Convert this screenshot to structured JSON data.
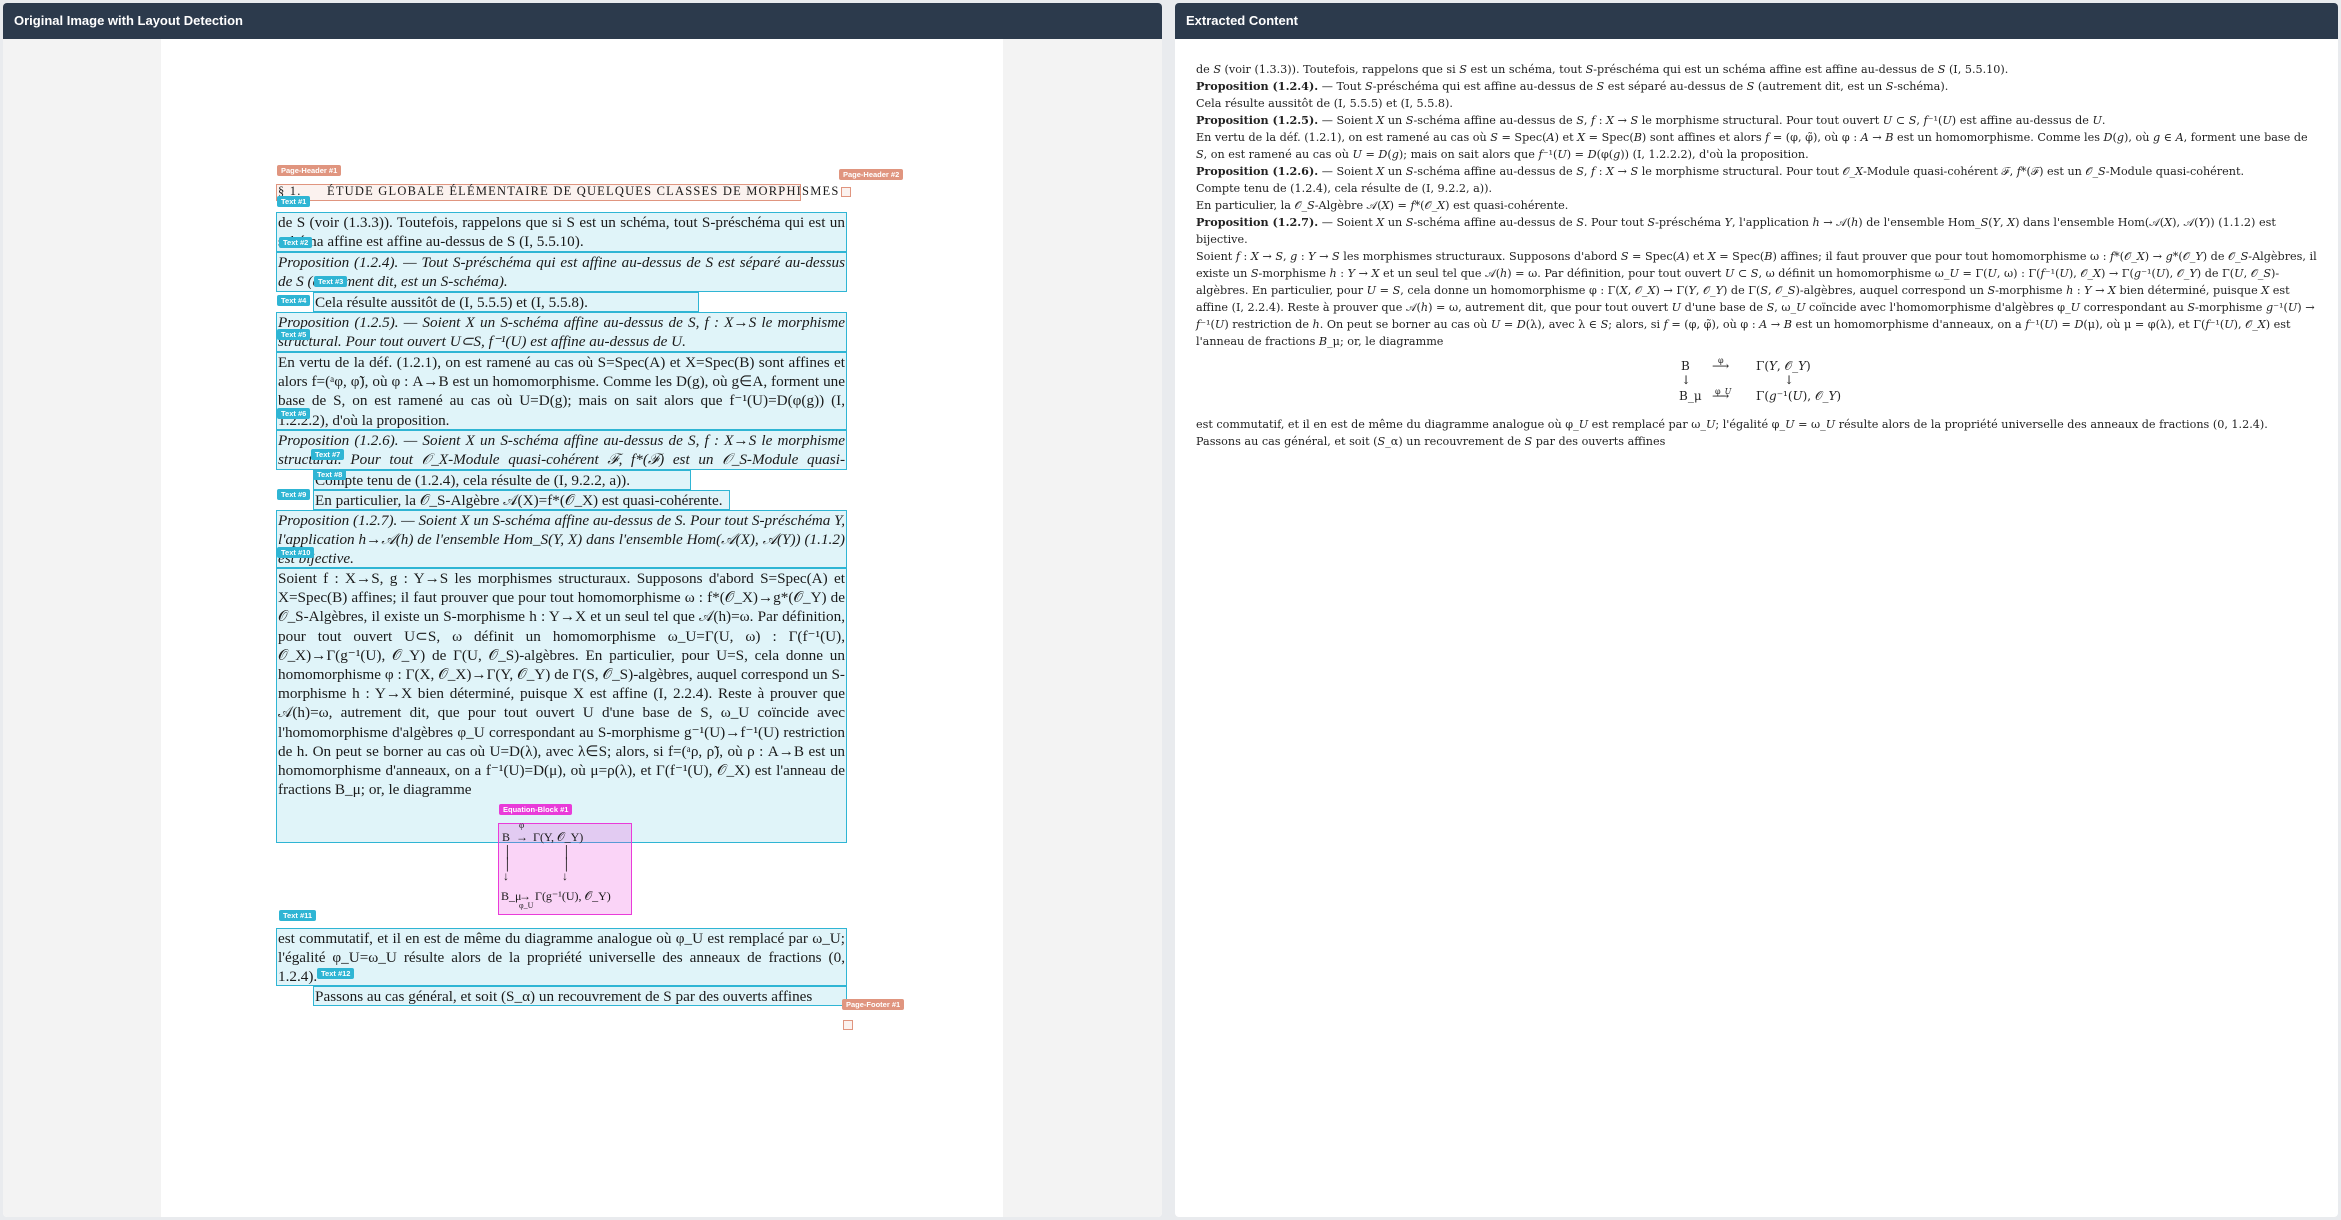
{
  "left_panel": {
    "title": "Original Image with Layout Detection"
  },
  "right_panel": {
    "title": "Extracted Content"
  },
  "page": {
    "header": {
      "section": "§ 1.",
      "title": "ÉTUDE GLOBALE ÉLÉMENTAIRE DE QUELQUES CLASSES DE MORPHISMES"
    },
    "labels": {
      "ph1": "Page-Header #1",
      "ph2": "Page-Header #2",
      "t1": "Text #1",
      "t2": "Text #2",
      "t3": "Text #3",
      "t4": "Text #4",
      "t5": "Text #5",
      "t6": "Text #6",
      "t7": "Text #7",
      "t8": "Text #8",
      "t9": "Text #9",
      "t10": "Text #10",
      "t11": "Text #11",
      "t12": "Text #12",
      "eq1": "Equation-Block #1",
      "pf1": "Page-Footer #1"
    },
    "text1": "de S (voir (1.3.3)). Toutefois, rappelons que si S est un schéma, tout S-préschéma qui est un schéma affine est affine au-dessus de S (I, 5.5.10).",
    "text2": "Proposition (1.2.4). — Tout S-préschéma qui est affine au-dessus de S est séparé au-dessus de S (autrement dit, est un S-schéma).",
    "text3": "Cela résulte aussitôt de (I, 5.5.5) et (I, 5.5.8).",
    "text4": "Proposition (1.2.5). — Soient X un S-schéma affine au-dessus de S, f : X→S le morphisme structural. Pour tout ouvert U⊂S, f⁻¹(U) est affine au-dessus de U.",
    "text5": "En vertu de la déf. (1.2.1), on est ramené au cas où S=Spec(A) et X=Spec(B) sont affines et alors f=(ᵃφ, φ̃), où φ : A→B est un homomorphisme. Comme les D(g), où g∈A, forment une base de S, on est ramené au cas où U=D(g); mais on sait alors que f⁻¹(U)=D(φ(g)) (I, 1.2.2.2), d'où la proposition.",
    "text6": "Proposition (1.2.6). — Soient X un S-schéma affine au-dessus de S, f : X→S le morphisme structural. Pour tout 𝒪_X-Module quasi-cohérent ℱ, f*(ℱ) est un 𝒪_S-Module quasi-cohérent.",
    "text7": "Compte tenu de (1.2.4), cela résulte de (I, 9.2.2, a)).",
    "text8": "En particulier, la 𝒪_S-Algèbre 𝒜(X)=f*(𝒪_X) est quasi-cohérente.",
    "text9": "Proposition (1.2.7). — Soient X un S-schéma affine au-dessus de S. Pour tout S-préschéma Y, l'application h→𝒜(h) de l'ensemble Hom_S(Y, X) dans l'ensemble Hom(𝒜(X), 𝒜(Y)) (1.1.2) est bijective.",
    "text10": "Soient f : X→S, g : Y→S les morphismes structuraux. Supposons d'abord S=Spec(A) et X=Spec(B) affines; il faut prouver que pour tout homomorphisme ω : f*(𝒪_X)→g*(𝒪_Y) de 𝒪_S-Algèbres, il existe un S-morphisme h : Y→X et un seul tel que 𝒜(h)=ω. Par définition, pour tout ouvert U⊂S, ω définit un homomorphisme ω_U=Γ(U, ω) : Γ(f⁻¹(U), 𝒪_X)→Γ(g⁻¹(U), 𝒪_Y) de Γ(U, 𝒪_S)-algèbres. En particulier, pour U=S, cela donne un homomorphisme φ : Γ(X, 𝒪_X)→Γ(Y, 𝒪_Y) de Γ(S, 𝒪_S)-algèbres, auquel correspond un S-morphisme h : Y→X bien déterminé, puisque X est affine (I, 2.2.4). Reste à prouver que 𝒜(h)=ω, autrement dit, que pour tout ouvert U d'une base de S, ω_U coïncide avec l'homomorphisme d'algèbres φ_U correspondant au S-morphisme g⁻¹(U)→f⁻¹(U) restriction de h. On peut se borner au cas où U=D(λ), avec λ∈S; alors, si f=(ᵃρ, ρ̃), où ρ : A→B est un homomorphisme d'anneaux, on a f⁻¹(U)=D(μ), où μ=ρ(λ), et Γ(f⁻¹(U), 𝒪_X) est l'anneau de fractions B_μ; or, le diagramme",
    "eq_B": "B",
    "eq_phi": "φ",
    "eq_GY": "Γ(Y, 𝒪_Y)",
    "eq_Bmu": "B_μ",
    "eq_phiU": "φ_U",
    "eq_Gg": "Γ(g⁻¹(U), 𝒪_Y)",
    "text11": "est commutatif, et il en est de même du diagramme analogue où φ_U est remplacé par ω_U; l'égalité φ_U=ω_U résulte alors de la propriété universelle des anneaux de fractions (0, 1.2.4).",
    "text12": "Passons au cas général, et soit (S_α) un recouvrement de S par des ouverts affines"
  },
  "extracted": {
    "p1": "de 𝑆 (voir (1.3.3)). Toutefois, rappelons que si 𝑆 est un schéma, tout 𝑆-préschéma qui est un schéma affine est affine au-dessus de 𝑆 (I, 5.5.10).",
    "p2_label": "Proposition (1.2.4).",
    "p2": " — Tout 𝑆-préschéma qui est affine au-dessus de 𝑆 est séparé au-dessus de 𝑆 (autrement dit, est un 𝑆-schéma).",
    "p3": "Cela résulte aussitôt de (I, 5.5.5) et (I, 5.5.8).",
    "p4_label": "Proposition (1.2.5).",
    "p4": " — Soient 𝑋 un 𝑆-schéma affine au-dessus de 𝑆, 𝑓 : 𝑋 → 𝑆 le morphisme structural. Pour tout ouvert 𝑈 ⊂ 𝑆, 𝑓⁻¹(𝑈) est affine au-dessus de 𝑈.",
    "p5": "En vertu de la déf. (1.2.1), on est ramené au cas où 𝑆 = Spec(𝐴) et 𝑋 = Spec(𝐵) sont affines et alors 𝑓 = (φ, φ̃), où φ : 𝐴 → 𝐵 est un homomorphisme. Comme les 𝐷(𝑔), où 𝑔 ∈ 𝐴, forment une base de 𝑆, on est ramené au cas où 𝑈 = 𝐷(𝑔); mais on sait alors que 𝑓⁻¹(𝑈) = 𝐷(φ(𝑔)) (I, 1.2.2.2), d'où la proposition.",
    "p6_label": "Proposition (1.2.6).",
    "p6": " — Soient 𝑋 un 𝑆-schéma affine au-dessus de 𝑆, 𝑓 : 𝑋 → 𝑆 le morphisme structural. Pour tout 𝒪_𝑋-Module quasi-cohérent ℱ, 𝑓*(ℱ) est un 𝒪_𝑆-Module quasi-cohérent.",
    "p7": "Compte tenu de (1.2.4), cela résulte de (I, 9.2.2, a)).",
    "p8": "En particulier, la 𝒪_𝑆-Algèbre 𝒜(𝑋) = 𝑓*(𝒪_𝑋) est quasi-cohérente.",
    "p9_label": "Proposition (1.2.7).",
    "p9": " — Soient 𝑋 un 𝑆-schéma affine au-dessus de 𝑆. Pour tout 𝑆-préschéma 𝑌, l'application ℎ → 𝒜(ℎ) de l'ensemble Hom_𝑆(𝑌, 𝑋) dans l'ensemble Hom(𝒜(𝑋), 𝒜(𝑌)) (1.1.2) est bijective.",
    "p10": "Soient 𝑓 : 𝑋 → 𝑆, 𝑔 : 𝑌 → 𝑆 les morphismes structuraux. Supposons d'abord 𝑆 = Spec(𝐴) et 𝑋 = Spec(𝐵) affines; il faut prouver que pour tout homomorphisme ω : 𝑓*(𝒪_𝑋) → 𝑔*(𝒪_𝑌) de 𝒪_𝑆-Algèbres, il existe un 𝑆-morphisme ℎ : 𝑌 → 𝑋 et un seul tel que 𝒜(ℎ) = ω. Par définition, pour tout ouvert 𝑈 ⊂ 𝑆, ω définit un homomorphisme ω_𝑈 = Γ(𝑈, ω) : Γ(𝑓⁻¹(𝑈), 𝒪_𝑋) → Γ(𝑔⁻¹(𝑈), 𝒪_𝑌) de Γ(𝑈, 𝒪_𝑆)-algèbres. En particulier, pour 𝑈 = 𝑆, cela donne un homomorphisme φ : Γ(𝑋, 𝒪_𝑋) → Γ(𝑌, 𝒪_𝑌) de Γ(𝑆, 𝒪_𝑆)-algèbres, auquel correspond un 𝑆-morphisme ℎ : 𝑌 → 𝑋 bien déterminé, puisque 𝑋 est affine (I, 2.2.4). Reste à prouver que 𝒜(ℎ) = ω, autrement dit, que pour tout ouvert 𝑈 d'une base de 𝑆, ω_𝑈 coïncide avec l'homomorphisme d'algèbres φ_𝑈 correspondant au 𝑆-morphisme 𝑔⁻¹(𝑈) → 𝑓⁻¹(𝑈) restriction de ℎ. On peut se borner au cas où 𝑈 = 𝐷(λ), avec λ ∈ 𝑆; alors, si 𝑓 = (φ, φ̃), où φ : 𝐴 → 𝐵 est un homomorphisme d'anneaux, on a 𝑓⁻¹(𝑈) = 𝐷(μ), où μ = φ(λ), et Γ(𝑓⁻¹(𝑈), 𝒪_𝑋) est l'anneau de fractions 𝐵_μ; or, le diagramme",
    "d_B": "B",
    "d_phi": "φ",
    "d_GY": "Γ(𝑌, 𝒪_𝑌)",
    "d_Bmu": "B_μ",
    "d_phiU": "φ_𝑈",
    "d_Gg": "Γ(𝑔⁻¹(𝑈), 𝒪_𝑌)",
    "p11": "est commutatif, et il en est de même du diagramme analogue où φ_𝑈 est remplacé par ω_𝑈; l'égalité φ_𝑈 = ω_𝑈 résulte alors de la propriété universelle des anneaux de fractions (0, 1.2.4).",
    "p12": "Passons au cas général, et soit (𝑆_α) un recouvrement de 𝑆 par des ouverts affines"
  }
}
